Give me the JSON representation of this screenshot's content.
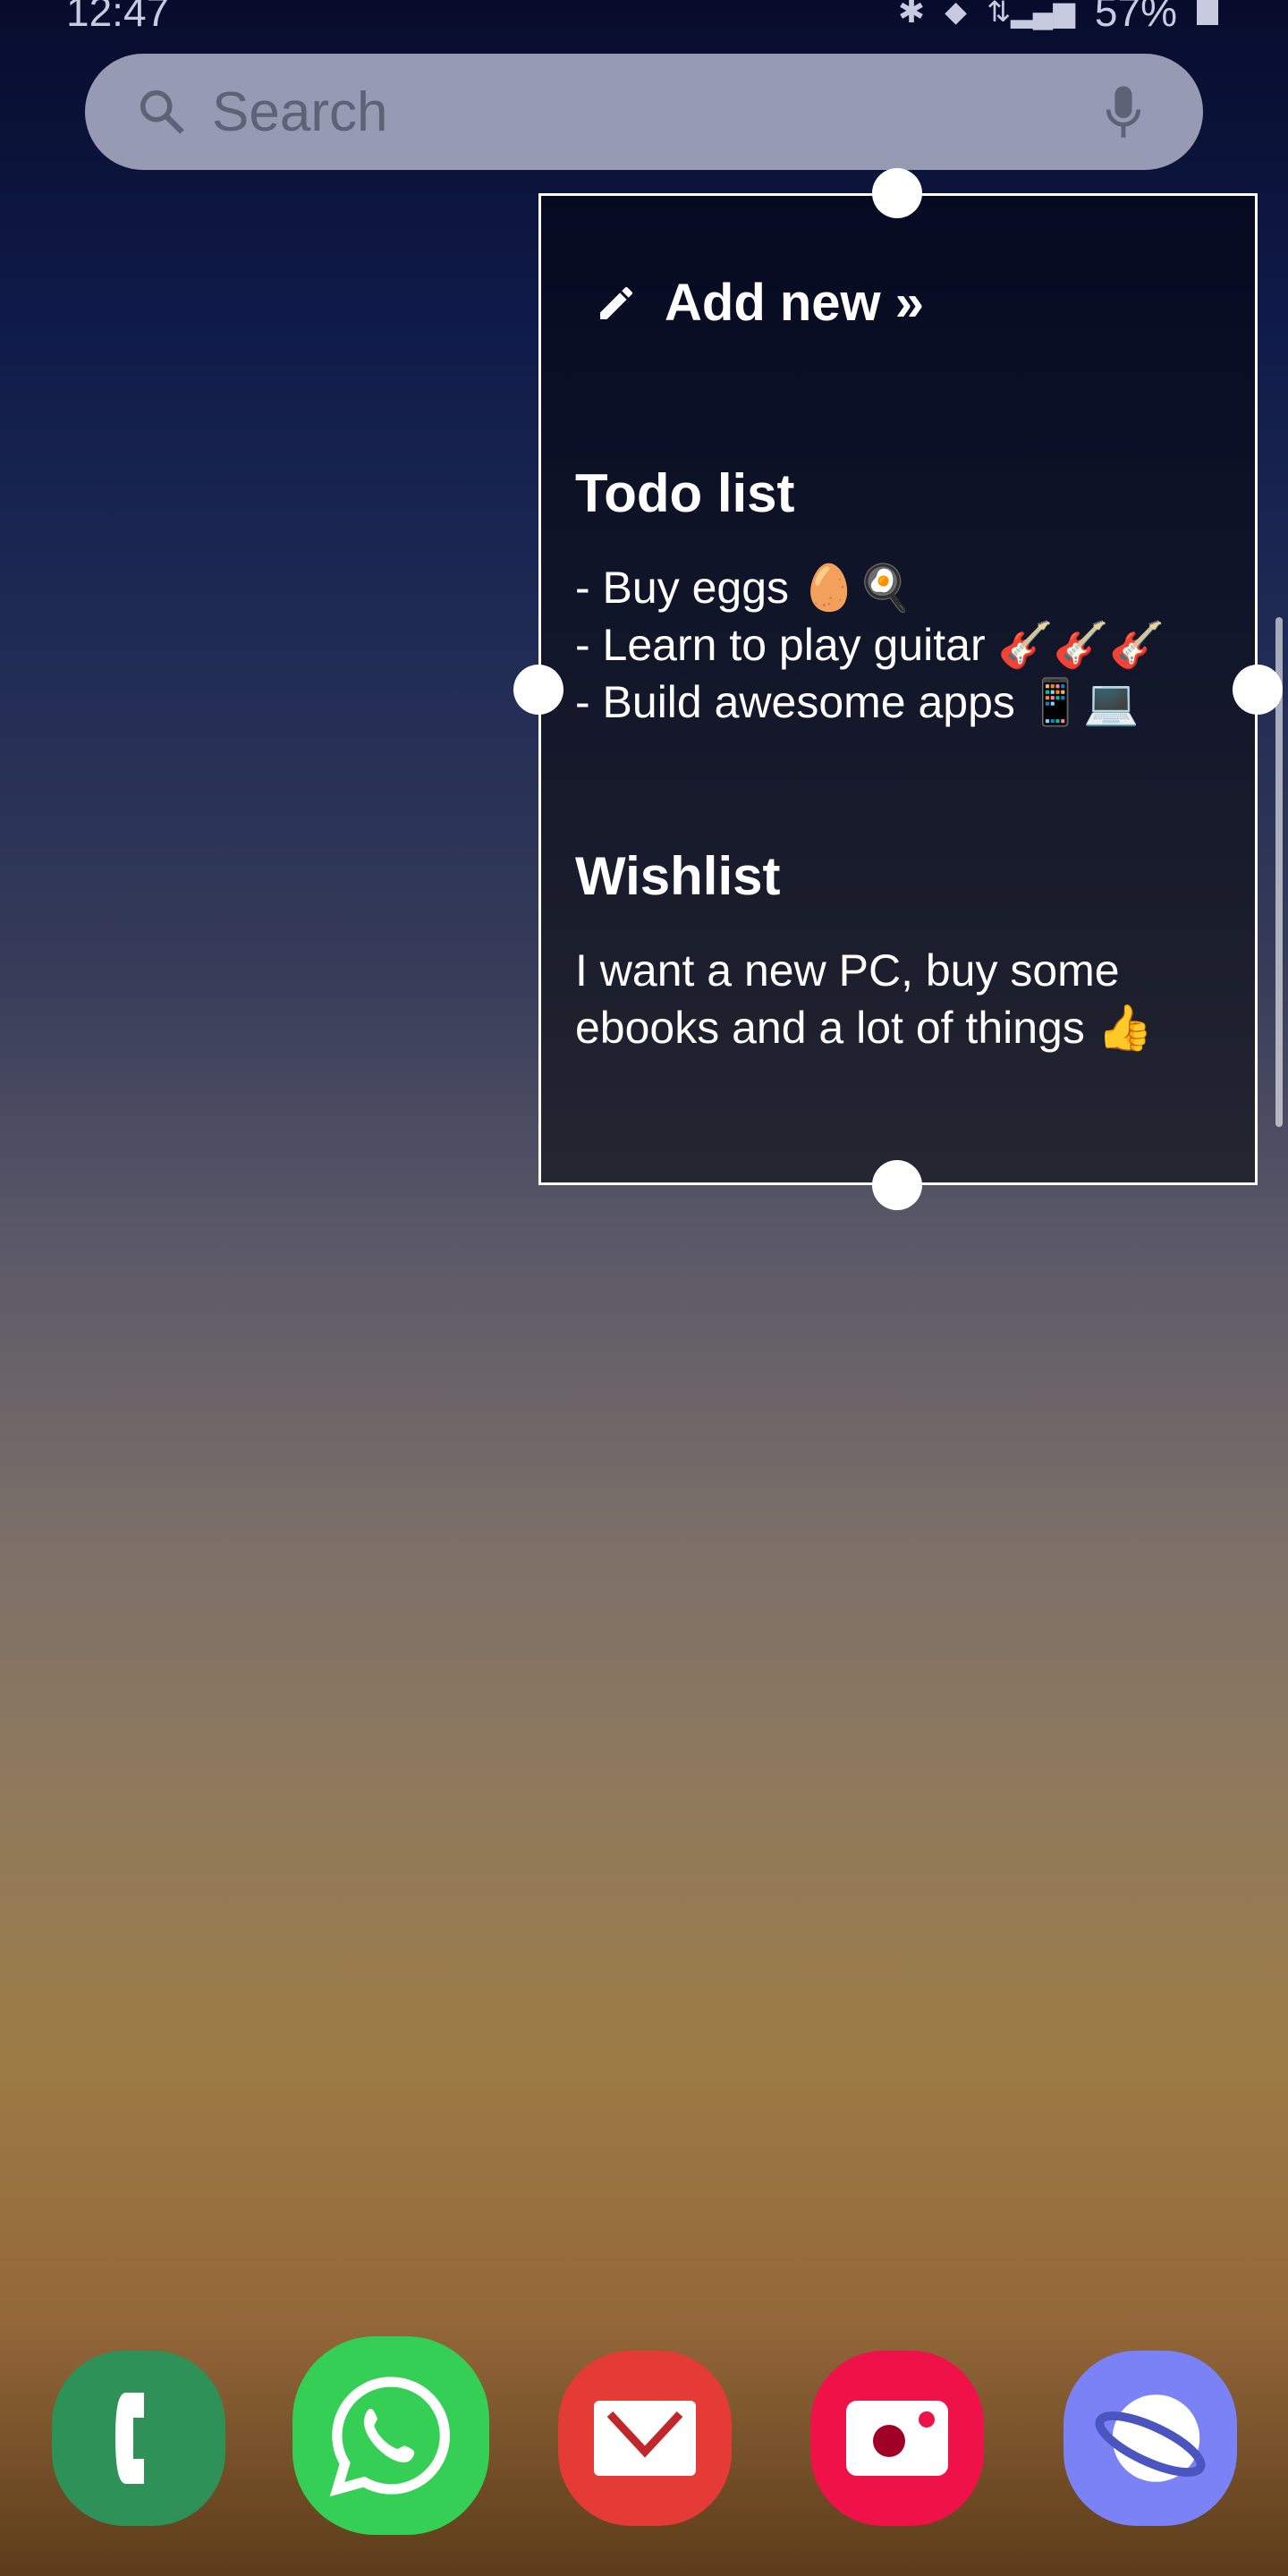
{
  "status_bar": {
    "time": "12:47",
    "battery": "57%",
    "icons": [
      "bluetooth-icon",
      "location-icon",
      "data-icon",
      "signal-icon",
      "battery-icon"
    ]
  },
  "search": {
    "placeholder": "Search",
    "icons": [
      "search-icon",
      "mic-icon"
    ]
  },
  "widget": {
    "add_new": "Add new »",
    "notes": [
      {
        "title": "Todo list",
        "body": "- Buy eggs 🥚🍳\n- Learn to play guitar 🎸🎸🎸\n- Build awesome apps 📱💻"
      },
      {
        "title": "Wishlist",
        "body": "I want a new PC, buy some\nebooks and a lot of things 👍"
      }
    ]
  },
  "dock": [
    {
      "name": "Phone",
      "color": "#2e9158"
    },
    {
      "name": "WhatsApp",
      "color": "#35cf55"
    },
    {
      "name": "Email",
      "color": "#e43b36"
    },
    {
      "name": "Camera",
      "color": "#ee1249"
    },
    {
      "name": "Internet",
      "color": "#7a82f6"
    }
  ]
}
